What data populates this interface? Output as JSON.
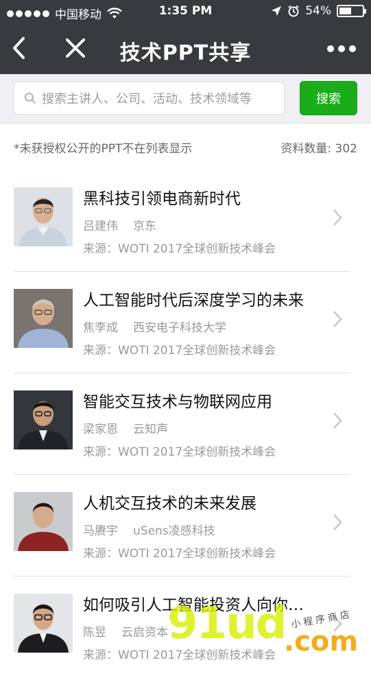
{
  "status_bar": {
    "carrier": "中国移动",
    "time": "1:35 PM",
    "battery": "54%",
    "battery_level": 0.54
  },
  "nav": {
    "title": "技术PPT共享"
  },
  "search": {
    "placeholder": "搜索主讲人、公司、活动、技术领域等",
    "button_label": "搜索"
  },
  "info": {
    "note": "*未获授权公开的PPT不在列表显示",
    "count_label": "资料数量: 302"
  },
  "items": [
    {
      "title": "黑科技引领电商新时代",
      "speaker": "吕建伟",
      "company": "京东",
      "source": "来源：WOTI 2017全球创新技术峰会"
    },
    {
      "title": "人工智能时代后深度学习的未来",
      "speaker": "焦李成",
      "company": "西安电子科技大学",
      "source": "来源：WOTI 2017全球创新技术峰会"
    },
    {
      "title": "智能交互技术与物联网应用",
      "speaker": "梁家恩",
      "company": "云知声",
      "source": "来源：WOTI 2017全球创新技术峰会"
    },
    {
      "title": "人机交互技术的未来发展",
      "speaker": "马赓宇",
      "company": "uSens凌感科技",
      "source": "来源：WOTI 2017全球创新技术峰会"
    },
    {
      "title": "如何吸引人工智能投资人向你投资",
      "speaker": "陈昱",
      "company": "云启资本",
      "source": "来源：WOTI 2017全球创新技术峰会"
    }
  ],
  "watermark": {
    "brand": "91ud",
    "suffix": ".com",
    "tagline": "小程序商店"
  },
  "colors": {
    "nav_bg": "#393a3f",
    "search_button": "#1aad19",
    "muted_text": "#999999"
  }
}
